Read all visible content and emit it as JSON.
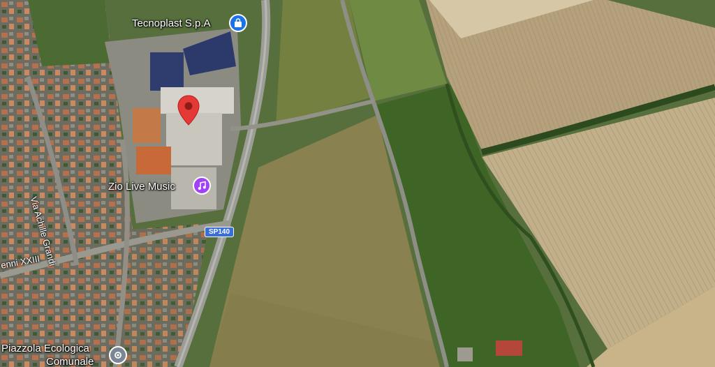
{
  "map": {
    "view": "satellite",
    "places": [
      {
        "key": "tecnoplast",
        "label": "Tecnoplast S.p.A",
        "icon": "shopping-bag-icon",
        "icon_color": "#1a73e8"
      },
      {
        "key": "zio",
        "label": "Zio Live Music",
        "icon": "music-icon",
        "icon_color": "#a142f4"
      },
      {
        "key": "piazzola",
        "label": "Piazzola Ecologica Comunale",
        "label_line1": "Piazzola Ecologica",
        "label_line2": "Comunale",
        "icon": "pin-icon",
        "icon_color": "#7b8794"
      }
    ],
    "streets": {
      "grandi": "Via Achille Grandi",
      "xxiii": "enni XXIII"
    },
    "route_shield": "SP140",
    "selected_pin_color": "#e53935"
  }
}
